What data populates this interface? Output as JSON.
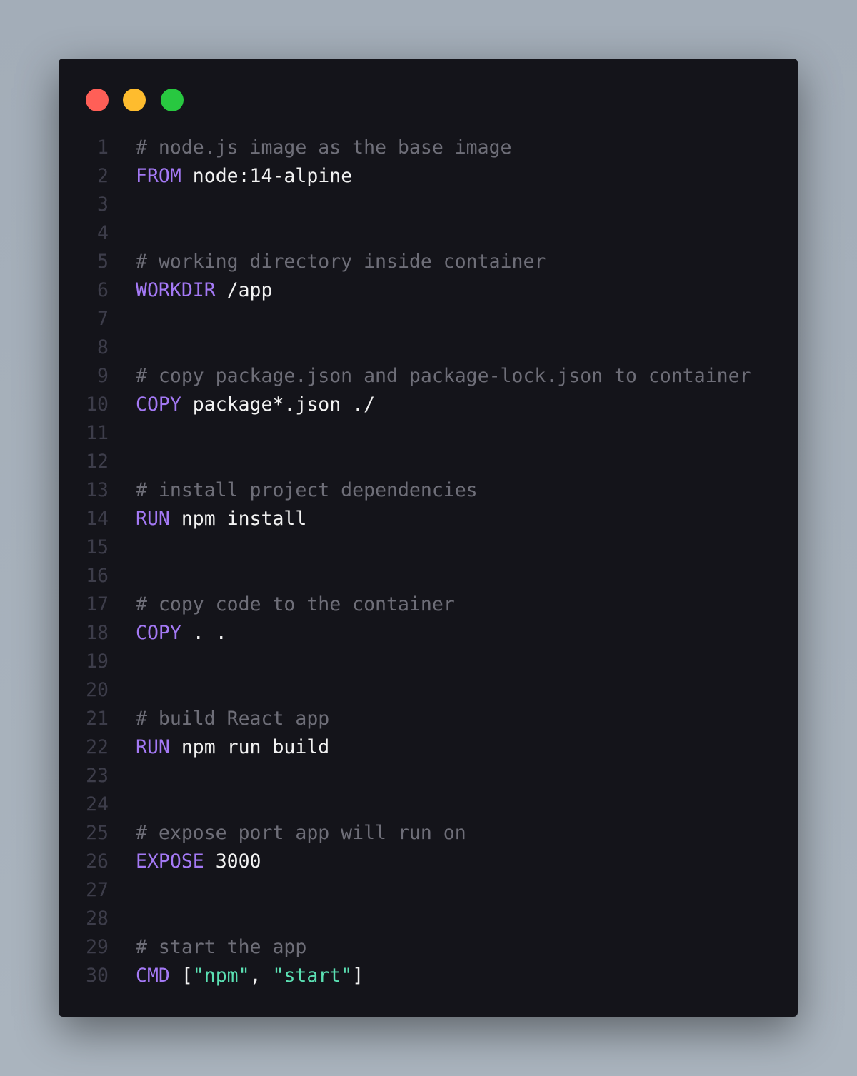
{
  "window": {
    "controls": [
      "close",
      "minimize",
      "maximize"
    ],
    "colors": {
      "close": "#ff5f57",
      "minimize": "#febc2e",
      "maximize": "#28c840",
      "background": "#14141a",
      "keyword": "#a479f5",
      "comment": "#6e6e78",
      "string": "#5be0b3"
    }
  },
  "code": {
    "lines": [
      {
        "n": "1",
        "tokens": [
          {
            "t": "# node.js image as the base image",
            "c": "comment"
          }
        ]
      },
      {
        "n": "2",
        "tokens": [
          {
            "t": "FROM",
            "c": "kw"
          },
          {
            "t": " node:14-alpine",
            "c": "plain"
          }
        ]
      },
      {
        "n": "3",
        "tokens": []
      },
      {
        "n": "4",
        "tokens": []
      },
      {
        "n": "5",
        "tokens": [
          {
            "t": "# working directory inside container",
            "c": "comment"
          }
        ]
      },
      {
        "n": "6",
        "tokens": [
          {
            "t": "WORKDIR",
            "c": "kw"
          },
          {
            "t": " /app",
            "c": "plain"
          }
        ]
      },
      {
        "n": "7",
        "tokens": []
      },
      {
        "n": "8",
        "tokens": []
      },
      {
        "n": "9",
        "tokens": [
          {
            "t": "# copy package.json and package-lock.json to container",
            "c": "comment"
          }
        ]
      },
      {
        "n": "10",
        "tokens": [
          {
            "t": "COPY",
            "c": "kw"
          },
          {
            "t": " package*.json ./",
            "c": "plain"
          }
        ]
      },
      {
        "n": "11",
        "tokens": []
      },
      {
        "n": "12",
        "tokens": []
      },
      {
        "n": "13",
        "tokens": [
          {
            "t": "# install project dependencies",
            "c": "comment"
          }
        ]
      },
      {
        "n": "14",
        "tokens": [
          {
            "t": "RUN",
            "c": "kw"
          },
          {
            "t": " npm install",
            "c": "plain"
          }
        ]
      },
      {
        "n": "15",
        "tokens": []
      },
      {
        "n": "16",
        "tokens": []
      },
      {
        "n": "17",
        "tokens": [
          {
            "t": "# copy code to the container",
            "c": "comment"
          }
        ]
      },
      {
        "n": "18",
        "tokens": [
          {
            "t": "COPY",
            "c": "kw"
          },
          {
            "t": " . .",
            "c": "plain"
          }
        ]
      },
      {
        "n": "19",
        "tokens": []
      },
      {
        "n": "20",
        "tokens": []
      },
      {
        "n": "21",
        "tokens": [
          {
            "t": "# build React app",
            "c": "comment"
          }
        ]
      },
      {
        "n": "22",
        "tokens": [
          {
            "t": "RUN",
            "c": "kw"
          },
          {
            "t": " npm run build",
            "c": "plain"
          }
        ]
      },
      {
        "n": "23",
        "tokens": []
      },
      {
        "n": "24",
        "tokens": []
      },
      {
        "n": "25",
        "tokens": [
          {
            "t": "# expose port app will run on",
            "c": "comment"
          }
        ]
      },
      {
        "n": "26",
        "tokens": [
          {
            "t": "EXPOSE",
            "c": "kw"
          },
          {
            "t": " 3000",
            "c": "plain"
          }
        ]
      },
      {
        "n": "27",
        "tokens": []
      },
      {
        "n": "28",
        "tokens": []
      },
      {
        "n": "29",
        "tokens": [
          {
            "t": "# start the app",
            "c": "comment"
          }
        ]
      },
      {
        "n": "30",
        "tokens": [
          {
            "t": "CMD",
            "c": "kw"
          },
          {
            "t": " [",
            "c": "plain"
          },
          {
            "t": "\"npm\"",
            "c": "str"
          },
          {
            "t": ", ",
            "c": "plain"
          },
          {
            "t": "\"start\"",
            "c": "str"
          },
          {
            "t": "]",
            "c": "plain"
          }
        ]
      }
    ]
  }
}
